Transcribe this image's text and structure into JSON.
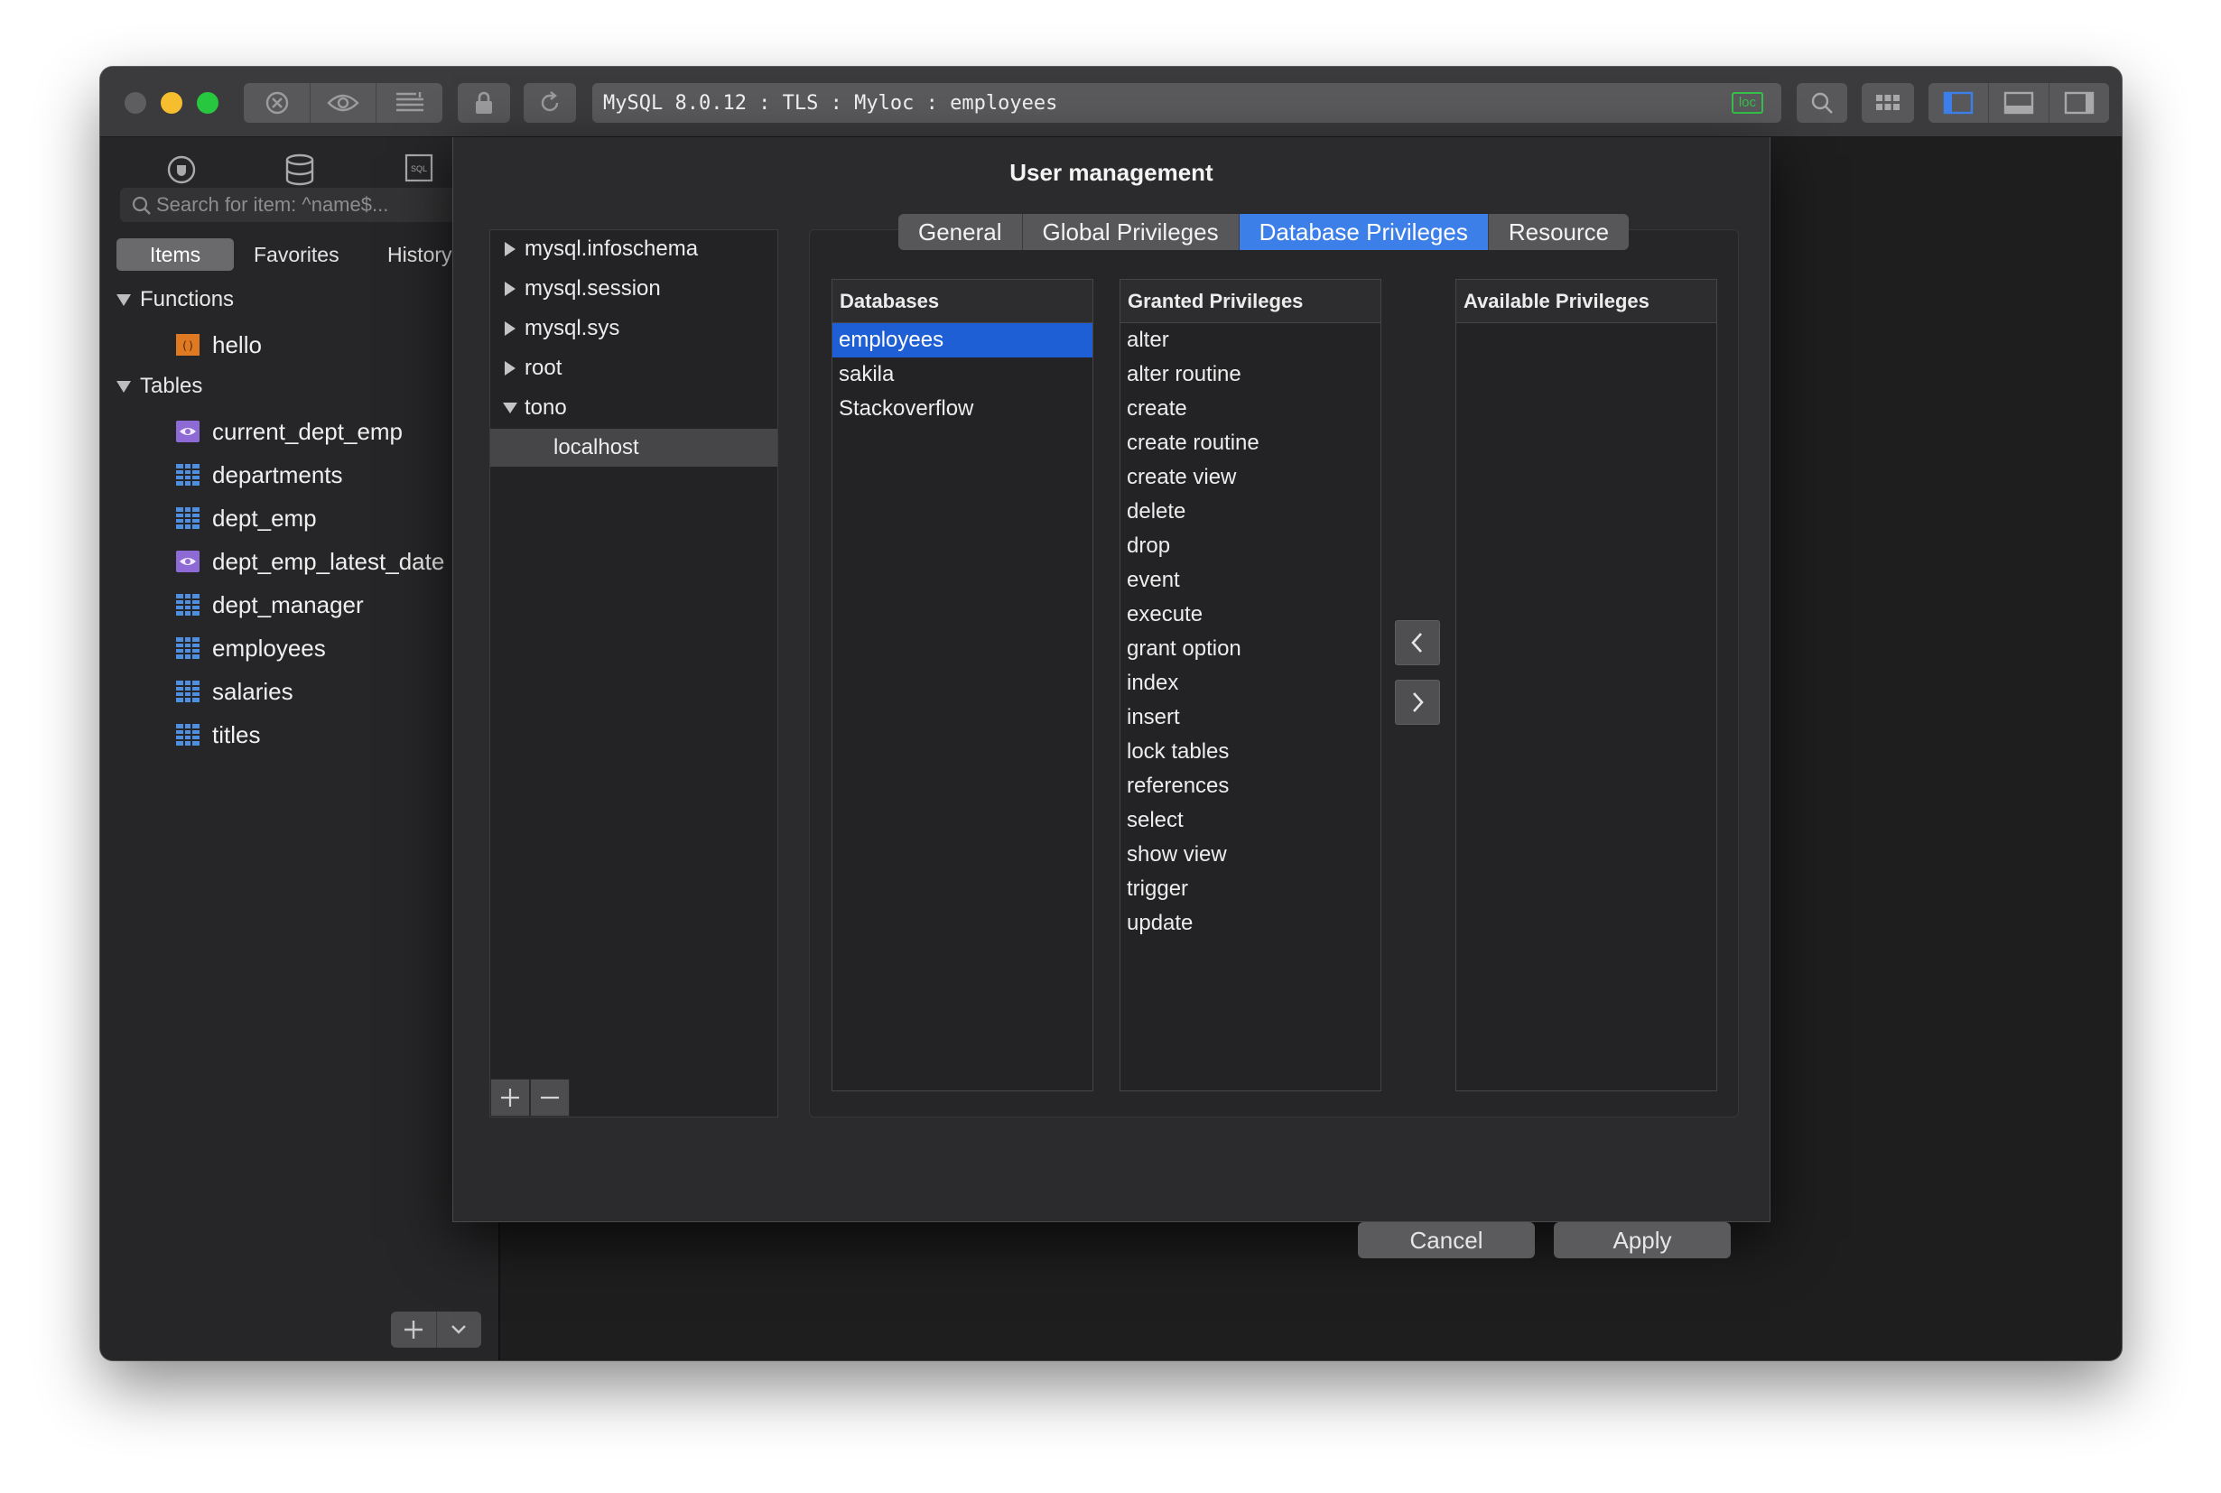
{
  "window": {
    "address": "MySQL 8.0.12 : TLS : Myloc : employees",
    "connection_badge": "loc",
    "badge_color": "#35c24a"
  },
  "sidebar": {
    "search_placeholder": "Search for item: ^name$...",
    "tabs": [
      {
        "label": "Items",
        "active": true
      },
      {
        "label": "Favorites",
        "active": false
      },
      {
        "label": "History",
        "active": false
      }
    ],
    "sections": [
      {
        "label": "Functions",
        "items": [
          {
            "label": "hello",
            "icon": "function-icon"
          }
        ]
      },
      {
        "label": "Tables",
        "items": [
          {
            "label": "current_dept_emp",
            "icon": "view-icon"
          },
          {
            "label": "departments",
            "icon": "table-icon"
          },
          {
            "label": "dept_emp",
            "icon": "table-icon"
          },
          {
            "label": "dept_emp_latest_date",
            "icon": "view-icon"
          },
          {
            "label": "dept_manager",
            "icon": "table-icon"
          },
          {
            "label": "employees",
            "icon": "table-icon"
          },
          {
            "label": "salaries",
            "icon": "table-icon"
          },
          {
            "label": "titles",
            "icon": "table-icon"
          }
        ]
      }
    ]
  },
  "dialog": {
    "title": "User management",
    "users": [
      {
        "label": "mysql.infoschema",
        "expanded": false
      },
      {
        "label": "mysql.session",
        "expanded": false
      },
      {
        "label": "mysql.sys",
        "expanded": false
      },
      {
        "label": "root",
        "expanded": false
      },
      {
        "label": "tono",
        "expanded": true
      },
      {
        "label": "localhost",
        "child": true,
        "selected": true
      }
    ],
    "tabs": [
      {
        "label": "General",
        "active": false
      },
      {
        "label": "Global Privileges",
        "active": false
      },
      {
        "label": "Database Privileges",
        "active": true
      },
      {
        "label": "Resource",
        "active": false
      }
    ],
    "databases": {
      "header": "Databases",
      "rows": [
        "employees",
        "sakila",
        "Stackoverflow"
      ],
      "selected": "employees"
    },
    "granted": {
      "header": "Granted Privileges",
      "rows": [
        "alter",
        "alter routine",
        "create",
        "create routine",
        "create view",
        "delete",
        "drop",
        "event",
        "execute",
        "grant option",
        "index",
        "insert",
        "lock tables",
        "references",
        "select",
        "show view",
        "trigger",
        "update"
      ]
    },
    "available": {
      "header": "Available Privileges",
      "rows": []
    },
    "buttons": {
      "cancel": "Cancel",
      "apply": "Apply"
    },
    "accent_color": "#3c7fe8",
    "selection_color": "#1f5fd6"
  }
}
